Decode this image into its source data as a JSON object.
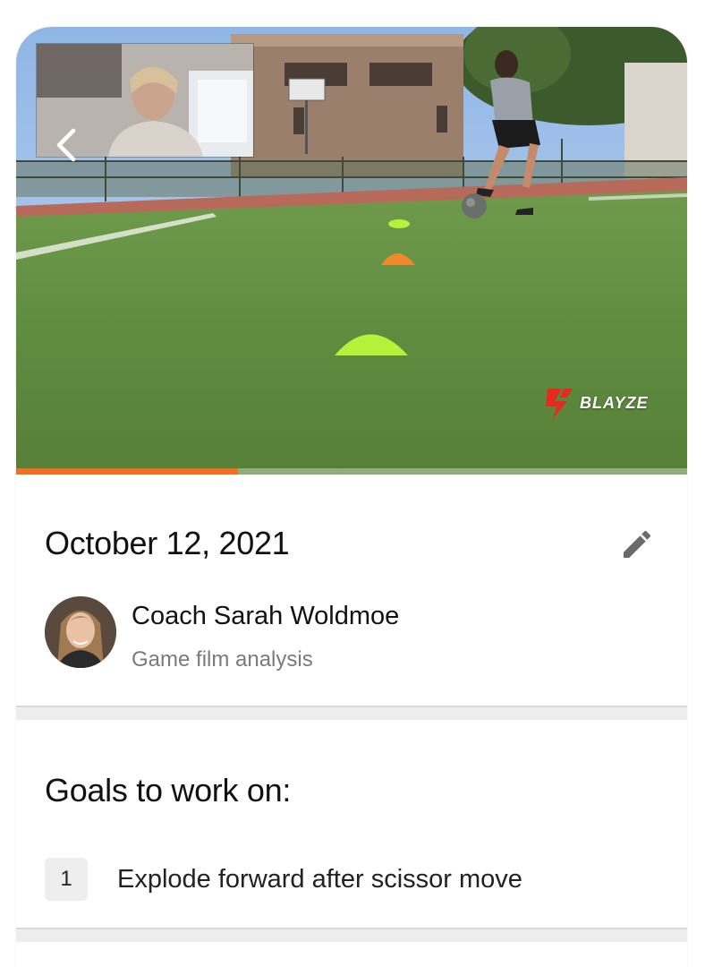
{
  "video": {
    "progress": 0.33,
    "watermark": "BLAYZE",
    "colors": {
      "progress": "#F26D21",
      "turf": "#5e8c3e",
      "cone_lime": "#b6f23a",
      "cone_orange": "#f0882a"
    }
  },
  "session": {
    "date": "October 12, 2021",
    "coach_name": "Coach Sarah Woldmoe",
    "session_type": "Game film analysis"
  },
  "goals": {
    "title": "Goals to work on:",
    "items": [
      {
        "number": "1",
        "text": "Explode forward after scissor move"
      }
    ]
  },
  "icons": {
    "back": "chevron-left-icon",
    "edit": "pencil-icon"
  }
}
